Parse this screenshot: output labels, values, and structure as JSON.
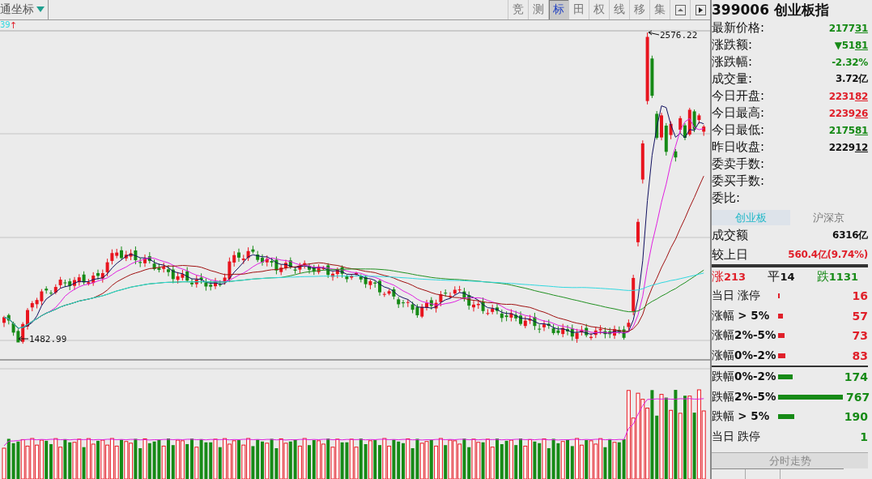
{
  "toolbar": {
    "coordinate_mode": "通坐标",
    "buttons": [
      {
        "kind": "text",
        "label": "竞",
        "selected": false
      },
      {
        "kind": "text",
        "label": "测",
        "selected": false
      },
      {
        "kind": "text",
        "label": "标",
        "selected": true
      },
      {
        "kind": "text",
        "label": "田",
        "selected": false
      },
      {
        "kind": "text",
        "label": "权",
        "selected": false
      },
      {
        "kind": "text",
        "label": "线",
        "selected": false
      },
      {
        "kind": "text",
        "label": "移",
        "selected": false
      },
      {
        "kind": "text",
        "label": "集",
        "selected": false
      },
      {
        "kind": "collapse",
        "selected": false
      },
      {
        "kind": "expand",
        "selected": false
      }
    ]
  },
  "chart": {
    "indicator_value": "39",
    "indicator_arrow": "↑",
    "high_label": "2576.22",
    "low_label": "1482.99"
  },
  "quote": {
    "code": "399006",
    "name": "创业板指",
    "rows": [
      {
        "label": "最新价格:",
        "main": "2177",
        "tail": "31",
        "color": "#168a16"
      },
      {
        "label": "涨跌额:",
        "main": "▼51",
        "tail": "81",
        "color": "#168a16"
      },
      {
        "label": "涨跌幅:",
        "main": "-2.32%",
        "color": "#168a16"
      },
      {
        "label": "成交量:",
        "main": "3.72亿",
        "color": "#111111"
      },
      {
        "label": "今日开盘:",
        "main": "2231",
        "tail": "82",
        "color": "#e0202a"
      },
      {
        "label": "今日最高:",
        "main": "2239",
        "tail": "26",
        "color": "#e0202a"
      },
      {
        "label": "今日最低:",
        "main": "2175",
        "tail": "81",
        "color": "#168a16"
      },
      {
        "label": "昨日收盘:",
        "main": "2229",
        "tail": "12",
        "color": "#111111"
      },
      {
        "label": "委卖手数:"
      },
      {
        "label": "委买手数:"
      },
      {
        "label": "委比:"
      }
    ]
  },
  "market": {
    "tabs": [
      {
        "label": "创业板",
        "selected": true
      },
      {
        "label": "沪深京",
        "selected": false
      }
    ],
    "turnover_label": "成交额",
    "turnover": "6316亿",
    "change_label": "较上日",
    "change": "560.4亿(9.74%)",
    "counts": [
      {
        "label": "涨",
        "value": "213",
        "color": "#e0202a"
      },
      {
        "label": "平",
        "value": "14",
        "color": "#111111"
      },
      {
        "label": "跌",
        "value": "1131",
        "color": "#168a16"
      }
    ],
    "breadth": [
      {
        "kind": "bar",
        "label": "当日 涨停",
        "count": "16",
        "color": "#e0202a"
      },
      {
        "kind": "bar",
        "label": "涨幅 **> 5%**",
        "count": "57",
        "color": "#e0202a"
      },
      {
        "kind": "bar",
        "label": "涨幅**2%-5%**",
        "count": "73",
        "color": "#e0202a"
      },
      {
        "kind": "bar",
        "label": "涨幅**0%-2%**",
        "count": "83",
        "color": "#e0202a"
      },
      {
        "kind": "bar",
        "label": "跌幅**0%-2%**",
        "count": "174",
        "color": "#168a16"
      },
      {
        "kind": "bar",
        "label": "跌幅**2%-5%**",
        "count": "767",
        "color": "#168a16"
      },
      {
        "kind": "bar",
        "label": "跌幅 **> 5%**",
        "count": "190",
        "color": "#168a16"
      },
      {
        "kind": "plain",
        "label": "当日 跌停",
        "count": "1",
        "color": "#168a16"
      }
    ],
    "footer_button": "分时走势"
  }
}
